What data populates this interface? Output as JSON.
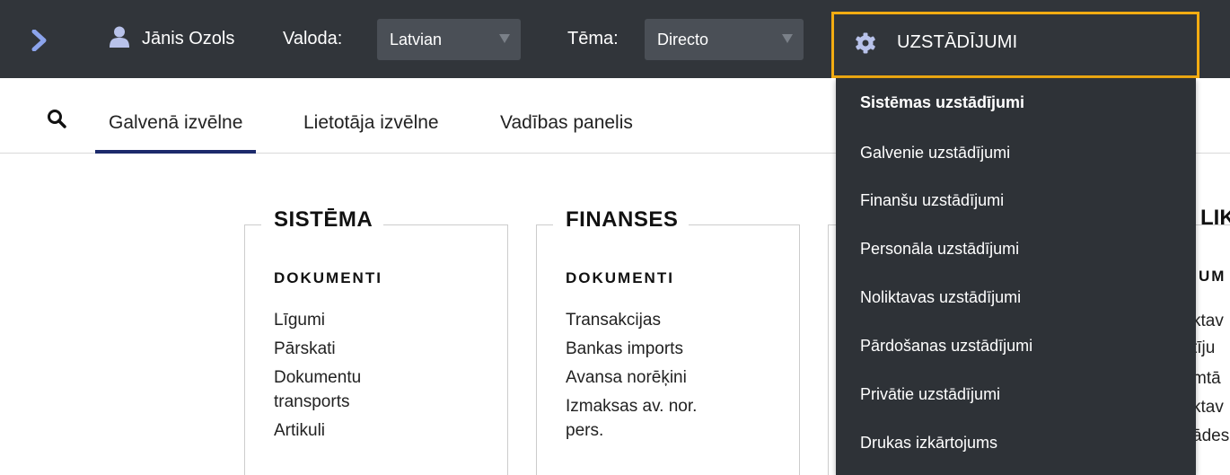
{
  "topbar": {
    "user_name": "Jānis Ozols",
    "language_label": "Valoda:",
    "language_value": "Latvian",
    "theme_label": "Tēma:",
    "theme_value": "Directo",
    "settings_label": "UZSTĀDĪJUMI",
    "accent_color": "#f3ac12"
  },
  "tabs": [
    {
      "label": "Galvenā izvēlne",
      "active": true
    },
    {
      "label": "Lietotāja izvēlne",
      "active": false
    },
    {
      "label": "Vadības panelis",
      "active": false
    }
  ],
  "columns": [
    {
      "title": "SISTĒMA",
      "subtitle": "DOKUMENTI",
      "items": [
        "Līgumi",
        "Pārskati",
        "Dokumentu transports",
        "Artikuli"
      ]
    },
    {
      "title": "FINANSES",
      "subtitle": "DOKUMENTI",
      "items": [
        "Transakcijas",
        "Bankas imports",
        "Avansa norēķini",
        "Izmaksas av. nor. pers."
      ]
    },
    {
      "title": "LIK",
      "subtitle": "UM",
      "fragments": [
        "ktav",
        "tīju",
        "mtā",
        "ktav",
        "ādes"
      ]
    }
  ],
  "settings_menu": {
    "items": [
      {
        "label": "Sistēmas uzstādījumi",
        "header": true
      },
      {
        "label": "Galvenie uzstādījumi"
      },
      {
        "label": "Finanšu uzstādījumi"
      },
      {
        "label": "Personāla uzstādījumi"
      },
      {
        "label": "Noliktavas uzstādījumi"
      },
      {
        "label": "Pārdošanas uzstādījumi"
      },
      {
        "label": "Privātie uzstādījumi"
      },
      {
        "label": "Drukas izkārtojums"
      }
    ]
  }
}
